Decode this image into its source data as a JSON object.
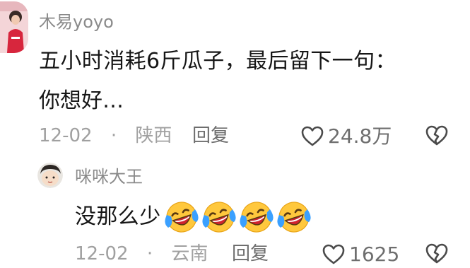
{
  "comment": {
    "username": "木易yoyo",
    "text_line1": "五小时消耗6斤瓜子，最后留下一句：",
    "text_line2": "你想好…",
    "date": "12-02",
    "separator": "·",
    "location": "陕西",
    "reply_label": "回复",
    "like_count": "24.8万",
    "like_icon": "heart-outline-icon",
    "dislike_icon": "broken-heart-icon"
  },
  "reply": {
    "username": "咪咪大王",
    "text": "没那么少",
    "emojis": [
      "laughing-crying-emoji",
      "laughing-crying-emoji",
      "laughing-crying-emoji",
      "laughing-crying-emoji"
    ],
    "date": "12-02",
    "separator": "·",
    "location": "云南",
    "reply_label": "回复",
    "like_count": "1625",
    "like_icon": "heart-outline-icon",
    "dislike_icon": "broken-heart-icon"
  },
  "colors": {
    "emoji_face": "#ffc83d",
    "emoji_tears": "#3aa0ff",
    "emoji_mouth": "#d0242f"
  }
}
